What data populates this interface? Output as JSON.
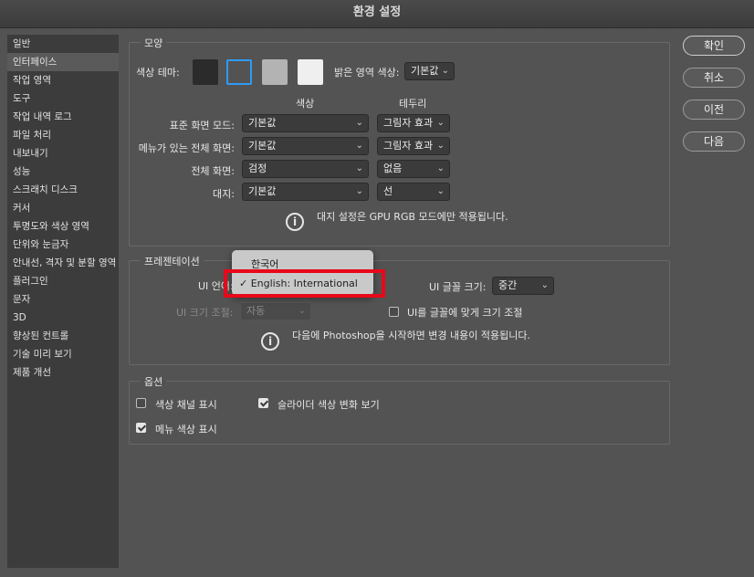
{
  "window": {
    "title": "환경 설정"
  },
  "sidebar": {
    "items": [
      {
        "label": "일반"
      },
      {
        "label": "인터페이스",
        "active": true
      },
      {
        "label": "작업 영역"
      },
      {
        "label": "도구"
      },
      {
        "label": "작업 내역 로그"
      },
      {
        "label": "파일 처리"
      },
      {
        "label": "내보내기"
      },
      {
        "label": "성능"
      },
      {
        "label": "스크래치 디스크"
      },
      {
        "label": "커서"
      },
      {
        "label": "투명도와 색상 영역"
      },
      {
        "label": "단위와 눈금자"
      },
      {
        "label": "안내선, 격자 및 분할 영역"
      },
      {
        "label": "플러그인"
      },
      {
        "label": "문자"
      },
      {
        "label": "3D"
      },
      {
        "label": "향상된 컨트롤"
      },
      {
        "label": "기술 미리 보기"
      },
      {
        "label": "제품 개선"
      }
    ]
  },
  "appearance": {
    "section_title": "모양",
    "color_theme_label": "색상 테마:",
    "theme_swatches": [
      "#2b2b2b",
      "#535353",
      "#b3b3b3",
      "#efefef"
    ],
    "selected_theme_index": 1,
    "highlight_color_label": "밝은 영역 색상:",
    "highlight_color_value": "기본값",
    "col_color": "색상",
    "col_border": "테두리",
    "rows": [
      {
        "label": "표준 화면 모드:",
        "color": "기본값",
        "border": "그림자 효과"
      },
      {
        "label": "메뉴가 있는 전체 화면:",
        "color": "기본값",
        "border": "그림자 효과"
      },
      {
        "label": "전체 화면:",
        "color": "검정",
        "border": "없음"
      },
      {
        "label": "대지:",
        "color": "기본값",
        "border": "선"
      }
    ],
    "info_text": "대지 설정은 GPU RGB 모드에만 적용됩니다."
  },
  "presentation": {
    "section_title": "프레젠테이션",
    "ui_language_label": "UI 언어:",
    "language_options": [
      "한국어",
      "English: International"
    ],
    "selected_language": "English: International",
    "checkmark": "✓",
    "ui_font_size_label": "UI 글꼴 크기:",
    "ui_font_size_value": "중간",
    "ui_scaling_label": "UI 크기 조절:",
    "ui_scaling_value": "자동",
    "scale_to_font_label": "UI를 글꼴에 맞게 크기 조절",
    "scale_to_font_checked": false,
    "info_text": "다음에 Photoshop을 시작하면 변경 내용이 적용됩니다."
  },
  "options": {
    "section_title": "옵션",
    "show_channels_in_color_label": "색상 채널 표시",
    "show_channels_in_color_checked": false,
    "dynamic_color_sliders_label": "슬라이더 색상 변화 보기",
    "dynamic_color_sliders_checked": true,
    "show_menu_colors_label": "메뉴 색상 표시",
    "show_menu_colors_checked": true
  },
  "buttons": {
    "ok": "확인",
    "cancel": "취소",
    "prev": "이전",
    "next": "다음"
  },
  "icons": {
    "info": "i",
    "chevron": "⌄"
  },
  "colors": {
    "annotation_box": "#e8081a",
    "selected_swatch_border": "#2f9bf3"
  }
}
